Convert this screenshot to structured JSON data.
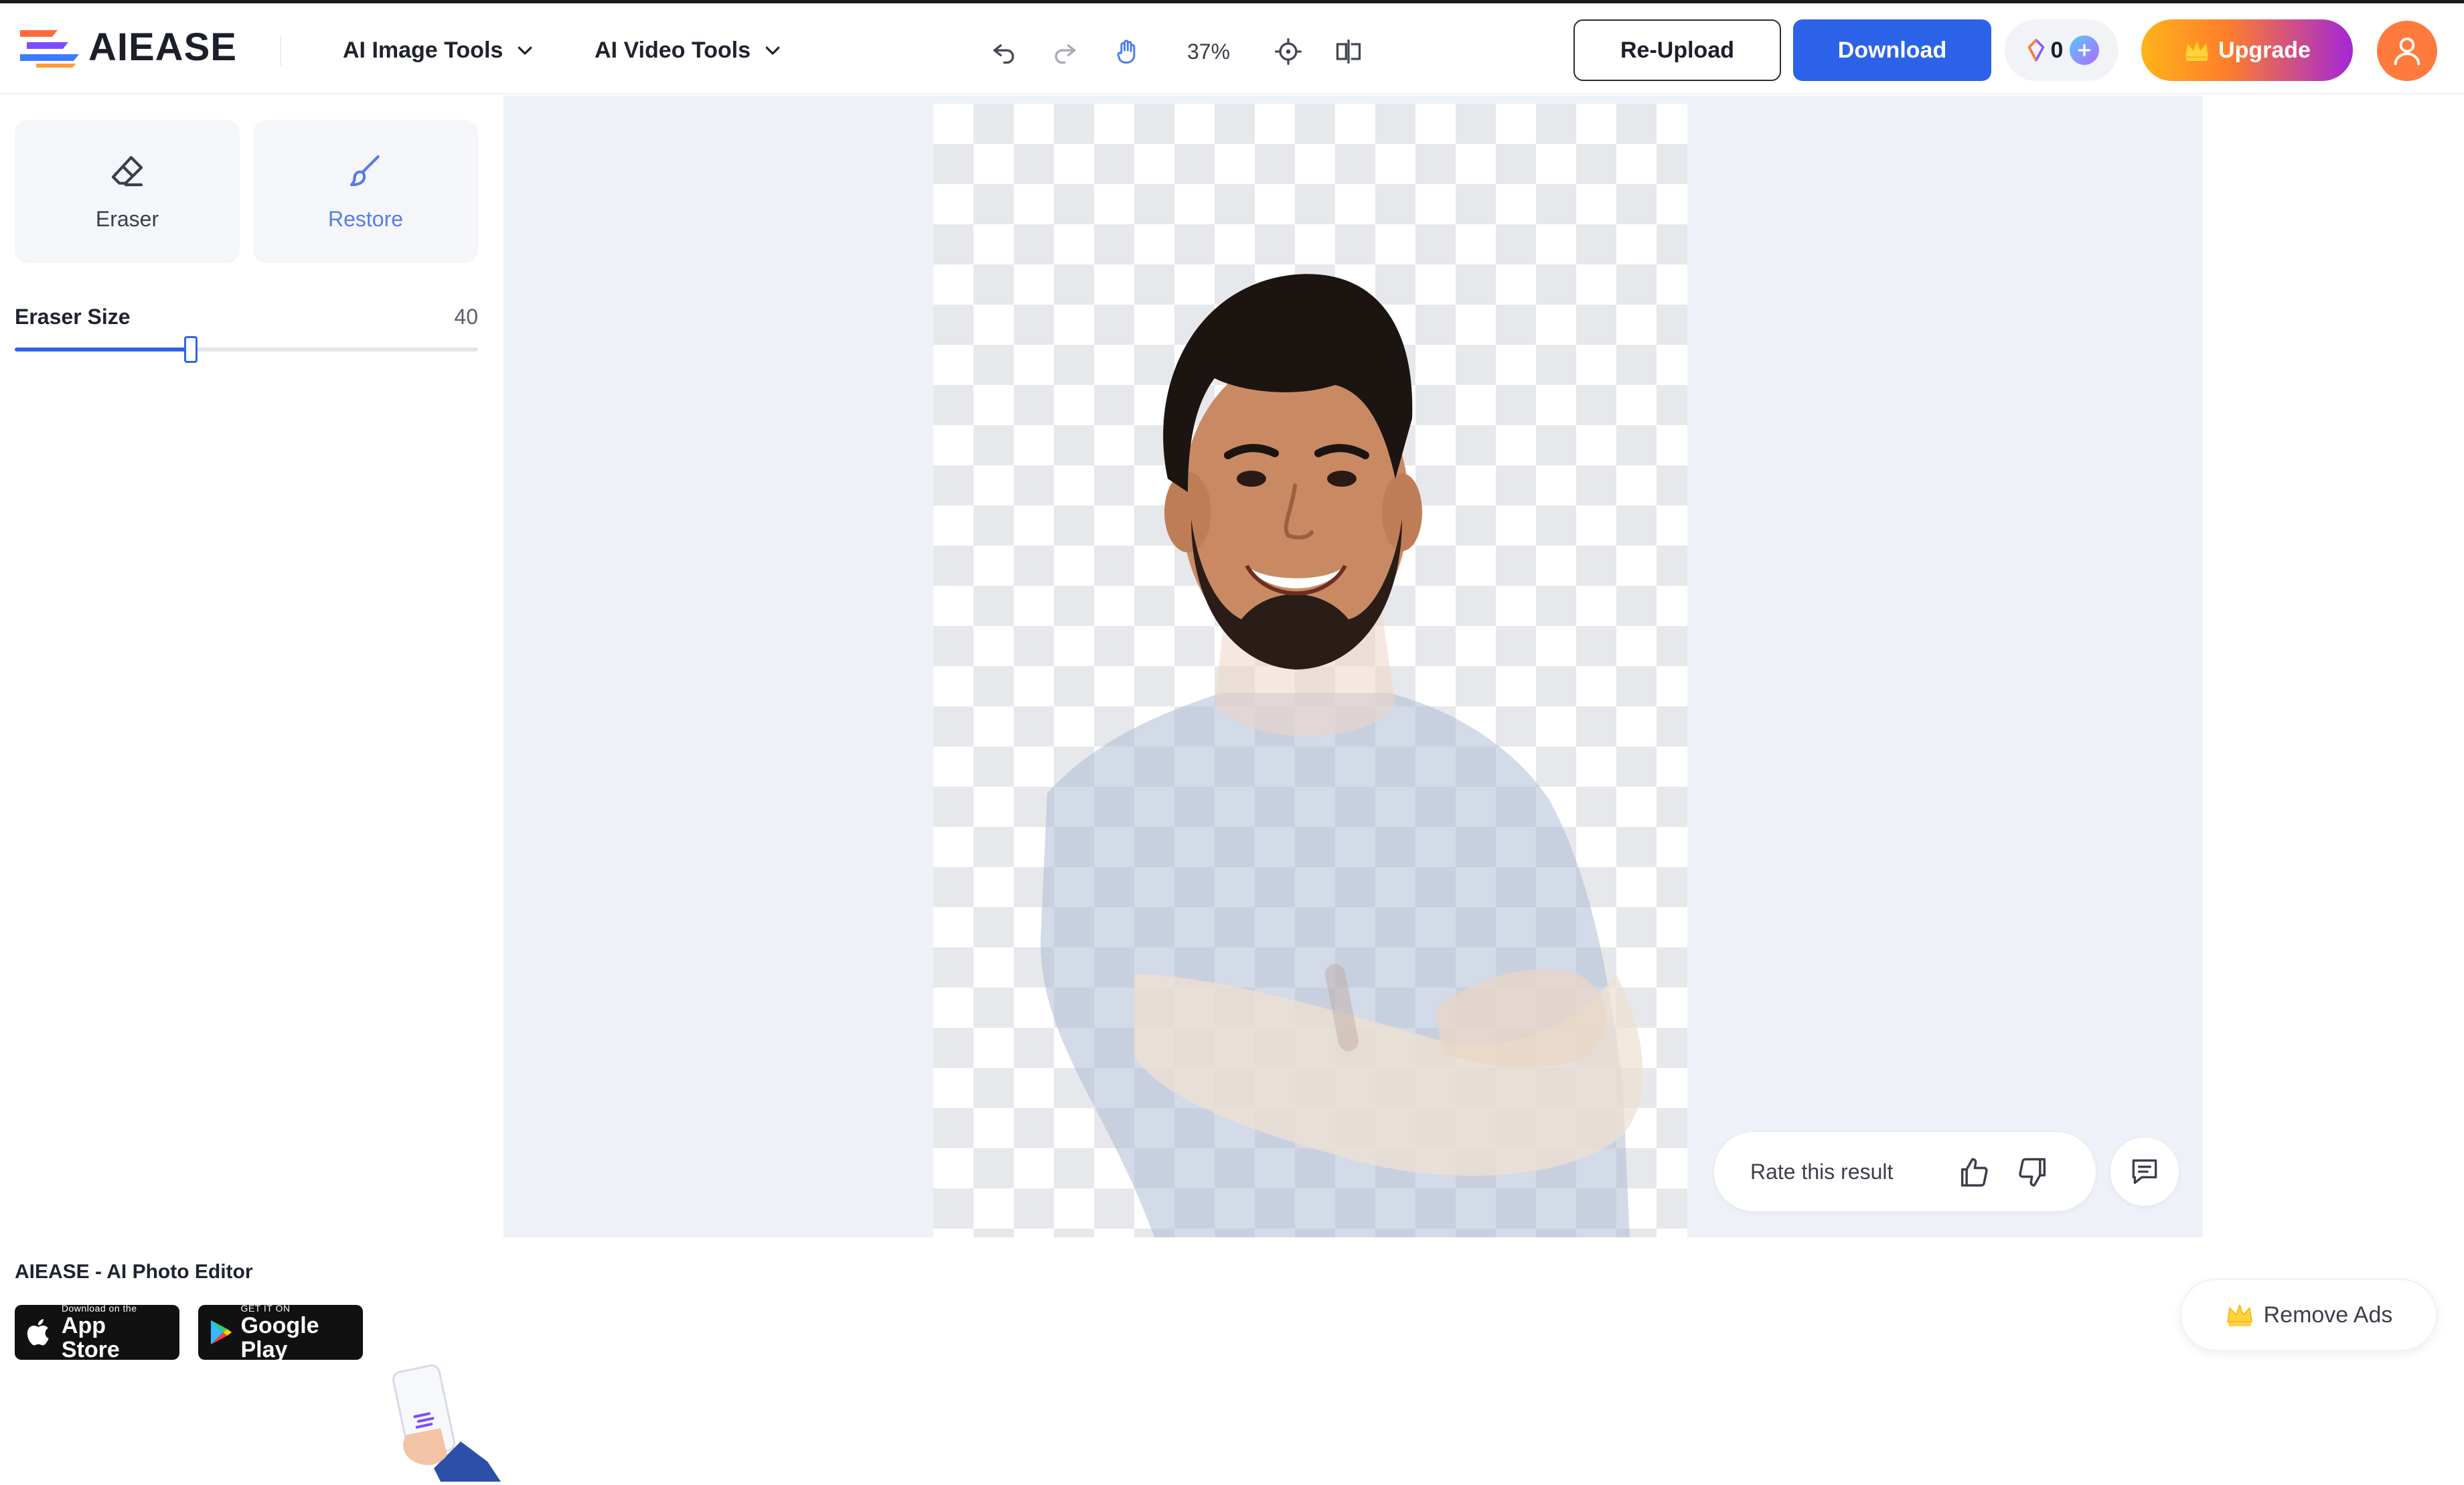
{
  "brand": {
    "name": "AIEASE"
  },
  "nav": {
    "image_tools": "AI Image Tools",
    "video_tools": "AI Video Tools"
  },
  "toolbar": {
    "zoom": "37%",
    "icons": [
      "undo-icon",
      "redo-icon",
      "hand-pan-icon",
      "fit-target-icon",
      "compare-icon"
    ]
  },
  "actions": {
    "reupload": "Re-Upload",
    "download": "Download",
    "credits": "0",
    "upgrade": "Upgrade"
  },
  "tools": {
    "eraser": "Eraser",
    "restore": "Restore"
  },
  "eraser_size": {
    "label": "Eraser Size",
    "value": "40",
    "fraction": 0.38
  },
  "app_promo": {
    "title": "AIEASE - AI Photo Editor",
    "apple_small": "Download on the",
    "apple_big": "App Store",
    "google_small": "GET IT ON",
    "google_big": "Google Play"
  },
  "rating": {
    "prompt": "Rate this result"
  },
  "ads": {
    "remove": "Remove Ads"
  },
  "colors": {
    "accent": "#2c62e8",
    "restore": "#5a7be6",
    "avatar": "#ff7a3d",
    "canvas_bg": "#eef2f8"
  }
}
